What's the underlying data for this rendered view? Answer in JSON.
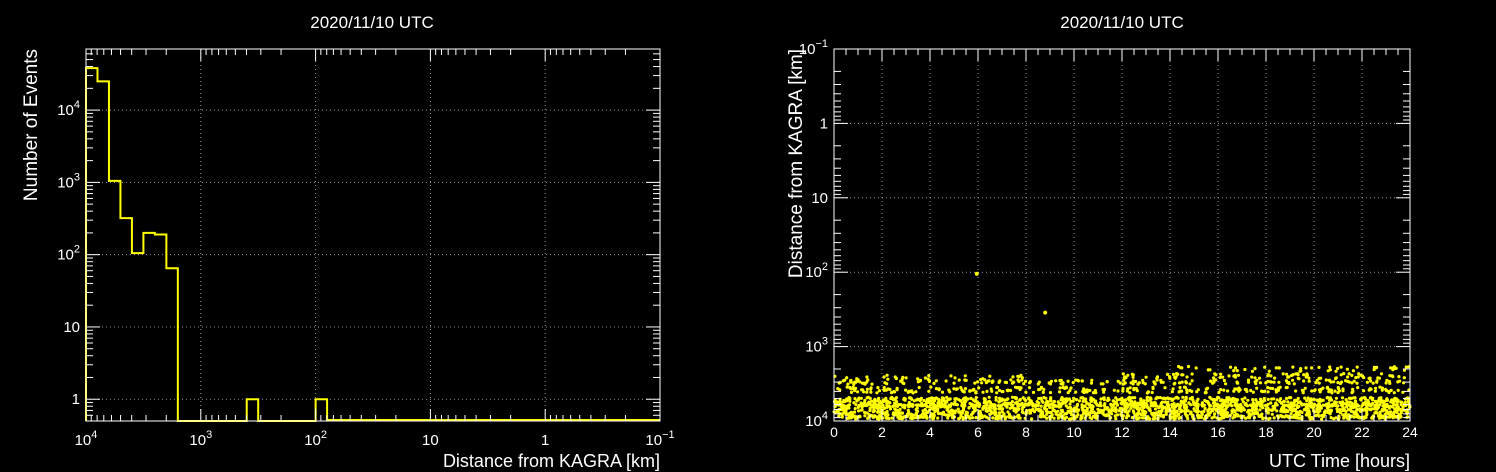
{
  "colors": {
    "background": "#000000",
    "frame": "#ffffff",
    "series": "#ffff00",
    "grid": "#9a9a9a"
  },
  "chart_data": [
    {
      "type": "bar",
      "subtype": "histogram",
      "title": "2020/11/10 UTC",
      "xlabel": "Distance from KAGRA [km]",
      "ylabel": "Number of Events",
      "x_scale": "log-reversed",
      "y_scale": "log",
      "xlim": [
        10000,
        0.1
      ],
      "ylim": [
        0.5,
        70000
      ],
      "x_ticks": [
        {
          "v": 10000,
          "label": "10",
          "sup": "4"
        },
        {
          "v": 1000,
          "label": "10",
          "sup": "3"
        },
        {
          "v": 100,
          "label": "10",
          "sup": "2"
        },
        {
          "v": 10,
          "label": "10",
          "sup": ""
        },
        {
          "v": 1,
          "label": "1",
          "sup": ""
        },
        {
          "v": 0.1,
          "label": "10",
          "sup": "−1"
        }
      ],
      "y_ticks": [
        {
          "v": 1,
          "label": "1",
          "sup": ""
        },
        {
          "v": 10,
          "label": "10",
          "sup": ""
        },
        {
          "v": 100,
          "label": "10",
          "sup": "2"
        },
        {
          "v": 1000,
          "label": "10",
          "sup": "3"
        },
        {
          "v": 10000,
          "label": "10",
          "sup": "4"
        }
      ],
      "grid": true,
      "bins": [
        {
          "x0": 10000,
          "x1": 7943,
          "count": 38000
        },
        {
          "x0": 7943,
          "x1": 6310,
          "count": 25000
        },
        {
          "x0": 6310,
          "x1": 5012,
          "count": 1050
        },
        {
          "x0": 5012,
          "x1": 3981,
          "count": 320
        },
        {
          "x0": 3981,
          "x1": 3162,
          "count": 105
        },
        {
          "x0": 3162,
          "x1": 2512,
          "count": 200
        },
        {
          "x0": 2512,
          "x1": 1995,
          "count": 190
        },
        {
          "x0": 1995,
          "x1": 1585,
          "count": 65
        },
        {
          "x0": 398.1,
          "x1": 316.2,
          "count": 1
        },
        {
          "x0": 100,
          "x1": 79.4,
          "count": 1
        }
      ]
    },
    {
      "type": "scatter",
      "title": "2020/11/10 UTC",
      "xlabel": "UTC Time [hours]",
      "ylabel": "Distance from KAGRA [km]",
      "x_scale": "linear",
      "y_scale": "log-reversed",
      "xlim": [
        0,
        24
      ],
      "ylim": [
        10000,
        0.1
      ],
      "x_ticks": [
        0,
        2,
        4,
        6,
        8,
        10,
        12,
        14,
        16,
        18,
        20,
        22,
        24
      ],
      "y_ticks": [
        {
          "v": 0.1,
          "label": "10",
          "sup": "−1"
        },
        {
          "v": 1,
          "label": "1",
          "sup": ""
        },
        {
          "v": 10,
          "label": "10",
          "sup": ""
        },
        {
          "v": 100,
          "label": "10",
          "sup": "2"
        },
        {
          "v": 1000,
          "label": "10",
          "sup": "3"
        },
        {
          "v": 10000,
          "label": "10",
          "sup": "4"
        }
      ],
      "grid": true,
      "isolated_points": [
        {
          "t": 5.95,
          "d": 105
        },
        {
          "t": 8.8,
          "d": 350
        }
      ],
      "dense_bands": [
        {
          "d_min": 6000,
          "d_max": 9800,
          "t0": 0,
          "t1": 24,
          "density": 60
        },
        {
          "d_min": 4800,
          "d_max": 6300,
          "t0": 0,
          "t1": 24,
          "density": 30
        },
        {
          "d_min": 3500,
          "d_max": 4200,
          "t0": 0,
          "t1": 24,
          "density": 10
        },
        {
          "d_min": 2800,
          "d_max": 3200,
          "t0": 0,
          "t1": 24,
          "density": 7
        },
        {
          "d_min": 2300,
          "d_max": 2700,
          "t0": 12,
          "t1": 24,
          "density": 7
        },
        {
          "d_min": 1850,
          "d_max": 2150,
          "t0": 14,
          "t1": 24,
          "density": 5
        },
        {
          "d_min": 2400,
          "d_max": 2900,
          "t0": 0,
          "t1": 8,
          "density": 4
        }
      ]
    }
  ]
}
